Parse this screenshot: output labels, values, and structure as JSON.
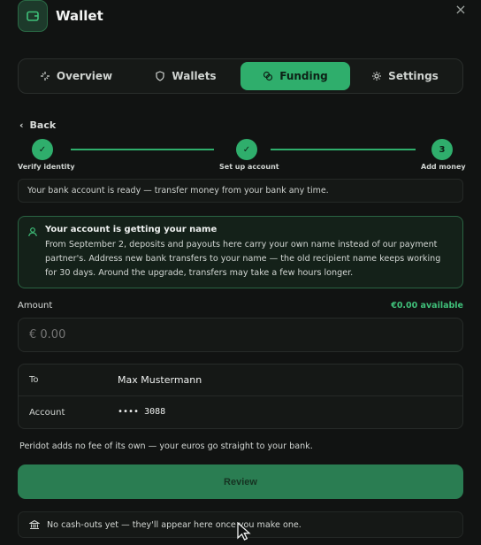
{
  "header": {
    "title": "Wallet",
    "close": "×"
  },
  "tabs": [
    {
      "label": "Overview",
      "icon": "sparkle-icon",
      "active": false
    },
    {
      "label": "Wallets",
      "icon": "shield-icon",
      "active": false
    },
    {
      "label": "Funding",
      "icon": "coins-icon",
      "active": true
    },
    {
      "label": "Settings",
      "icon": "gear-icon",
      "active": false
    }
  ],
  "back_label": "Back",
  "stepper": {
    "steps": [
      {
        "label": "Verify identity",
        "state": "done",
        "marker": "✓"
      },
      {
        "label": "Set up account",
        "state": "done",
        "marker": "✓"
      },
      {
        "label": "Add money",
        "state": "current",
        "marker": "3"
      }
    ]
  },
  "ready_text": "Your bank account is ready — transfer money from your bank any time.",
  "notice": {
    "title": "Your account is getting your name",
    "body": "From September 2, deposits and payouts here carry your own name instead of our payment partner's. Address new bank transfers to your name — the old recipient name keeps working for 30 days. Around the upgrade, transfers may take a few hours longer."
  },
  "amount": {
    "label": "Amount",
    "available": "€0.00 available",
    "placeholder": "€ 0.00"
  },
  "details": {
    "to_key": "To",
    "to_value": "Max Mustermann",
    "account_key": "Account",
    "account_value": "•••• 3088"
  },
  "fee_note": "Peridot adds no fee of its own — your euros go straight to your bank.",
  "review_label": "Review",
  "cashouts_text": "No cash-outs yet — they'll appear here once you make one.",
  "colors": {
    "accent": "#2fae6c",
    "accent_text": "#3fbf79",
    "background": "#111312"
  }
}
